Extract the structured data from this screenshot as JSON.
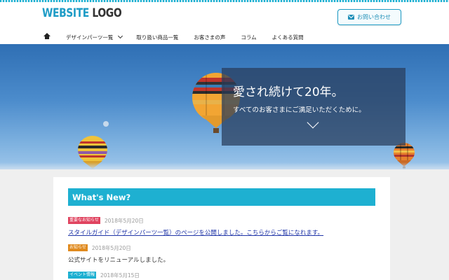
{
  "header": {
    "logo_accent": "WEBSITE",
    "logo_rest": "LOGO",
    "contact_label": "お問い合わせ",
    "contact_icon": "mail-icon"
  },
  "nav": {
    "home_icon": "home-icon",
    "items": [
      "デザインパーツ一覧",
      "取り扱い商品一覧",
      "お客さまの声",
      "コラム",
      "よくある質問"
    ]
  },
  "hero": {
    "title": "愛され続けて20年。",
    "subtitle": "すべてのお客さまにご満足いただくために。",
    "scroll_icon": "chevron-down-icon"
  },
  "news": {
    "heading": "What's New?",
    "items": [
      {
        "badge": "重要なお知らせ",
        "badge_color": "#e0435f",
        "date": "2018年5月20日",
        "text": "スタイルガイド（デザインパーツ一覧）のページを公開しました。こちらからご覧になれます。",
        "is_link": true
      },
      {
        "badge": "お知らせ",
        "badge_color": "#e08a1e",
        "date": "2018年5月20日",
        "text": "公式サイトをリニューアルしました。",
        "is_link": false
      },
      {
        "badge": "イベント情報",
        "badge_color": "#1eb0d1",
        "date": "2018年5月15日",
        "text": "",
        "is_link": false
      }
    ]
  },
  "colors": {
    "accent": "#1eb0d1",
    "link": "#2136a8"
  }
}
